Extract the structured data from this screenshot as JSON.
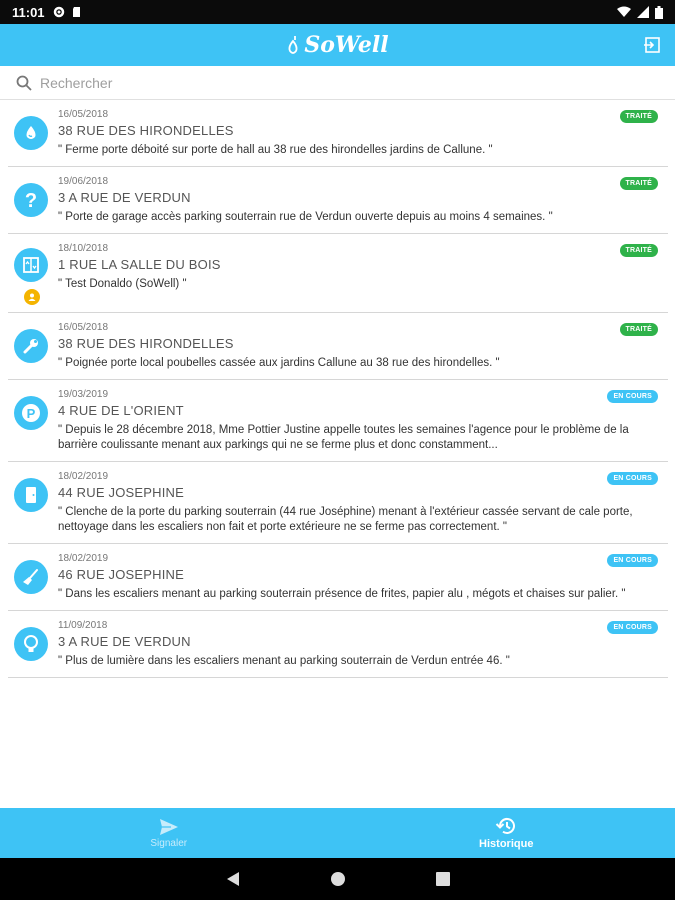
{
  "status_bar": {
    "time": "11:01"
  },
  "app": {
    "title": "SoWell"
  },
  "search": {
    "placeholder": "Rechercher"
  },
  "colors": {
    "primary": "#3ec3f5",
    "done": "#2fb24a",
    "in_progress": "#3ec3f5"
  },
  "reports": [
    {
      "date": "16/05/2018",
      "address": "38 RUE DES HIRONDELLES",
      "description": "\" Ferme porte déboité sur porte de hall au 38 rue des hirondelles jardins de Callune. \"",
      "status": "TRAITÉ",
      "status_type": "done",
      "icon": "water-drop-icon",
      "has_user": false
    },
    {
      "date": "19/06/2018",
      "address": "3 A RUE DE VERDUN",
      "description": "\" Porte de garage accès parking souterrain rue de Verdun ouverte depuis au moins 4 semaines. \"",
      "status": "TRAITÉ",
      "status_type": "done",
      "icon": "question-icon",
      "has_user": false
    },
    {
      "date": "18/10/2018",
      "address": "1 RUE LA SALLE DU BOIS",
      "description": "\" Test Donaldo (SoWell) \"",
      "status": "TRAITÉ",
      "status_type": "done",
      "icon": "elevator-icon",
      "has_user": true
    },
    {
      "date": "16/05/2018",
      "address": "38 RUE DES HIRONDELLES",
      "description": "\" Poignée porte local poubelles cassée aux jardins Callune au 38 rue des hirondelles. \"",
      "status": "TRAITÉ",
      "status_type": "done",
      "icon": "wrench-icon",
      "has_user": false
    },
    {
      "date": "19/03/2019",
      "address": "4 RUE DE L'ORIENT",
      "description": "\" Depuis le 28 décembre 2018, Mme Pottier Justine appelle toutes les semaines l'agence pour le problème de la barrière coulissante menant aux parkings qui ne se ferme plus et donc constamment...",
      "status": "EN COURS",
      "status_type": "in_progress",
      "icon": "parking-icon",
      "has_user": false
    },
    {
      "date": "18/02/2019",
      "address": "44 RUE JOSEPHINE",
      "description": "\" Clenche de la porte du parking souterrain (44 rue Joséphine) menant à l'extérieur cassée servant de cale porte, nettoyage dans les escaliers non fait et porte extérieure ne se ferme pas correctement. \"",
      "status": "EN COURS",
      "status_type": "in_progress",
      "icon": "door-icon",
      "has_user": false
    },
    {
      "date": "18/02/2019",
      "address": "46 RUE JOSEPHINE",
      "description": "\" Dans les escaliers menant au parking souterrain présence de frites, papier alu , mégots et chaises sur palier. \"",
      "status": "EN COURS",
      "status_type": "in_progress",
      "icon": "broom-icon",
      "has_user": false
    },
    {
      "date": "11/09/2018",
      "address": "3 A RUE DE VERDUN",
      "description": "\" Plus de lumière dans les escaliers menant au parking souterrain de Verdun entrée 46. \"",
      "status": "EN COURS",
      "status_type": "in_progress",
      "icon": "lightbulb-icon",
      "has_user": false
    }
  ],
  "bottom_nav": [
    {
      "label": "Signaler",
      "icon": "send-icon",
      "active": false
    },
    {
      "label": "Historique",
      "icon": "history-icon",
      "active": true
    }
  ]
}
